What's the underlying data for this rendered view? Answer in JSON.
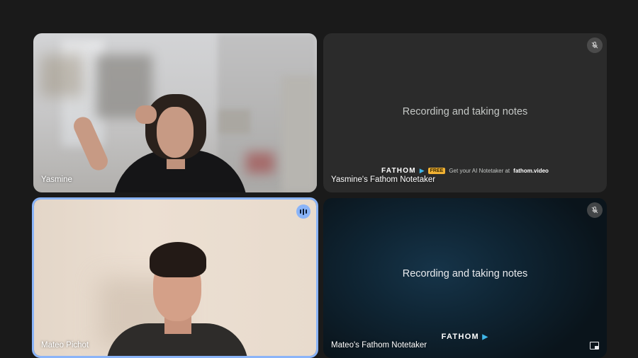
{
  "participants": [
    {
      "name": "Yasmine",
      "type": "camera",
      "speaking": false
    },
    {
      "name": "Yasmine's Fathom Notetaker",
      "type": "notetaker",
      "message": "Recording and taking notes",
      "muted": true,
      "promo": {
        "brand": "FATHOM",
        "badge": "FREE",
        "text": "Get your AI Notetaker at",
        "site": "fathom.video"
      }
    },
    {
      "name": "Mateo Pichot",
      "type": "camera",
      "speaking": true
    },
    {
      "name": "Mateo's Fathom Notetaker",
      "type": "notetaker",
      "message": "Recording and taking notes",
      "muted": true,
      "brand": "FATHOM"
    }
  ],
  "icons": {
    "muted": "mic-off-icon",
    "speaking": "audio-level-icon",
    "pip": "picture-in-picture-icon",
    "brand_arrow": "fathom-arrow-icon"
  },
  "colors": {
    "background": "#1a1a1a",
    "active_speaker_border": "#8ab4f8",
    "notetaker_tile": "#2b2b2b",
    "free_badge": "#f2b233",
    "fathom_arrow": "#3fb6e8"
  }
}
